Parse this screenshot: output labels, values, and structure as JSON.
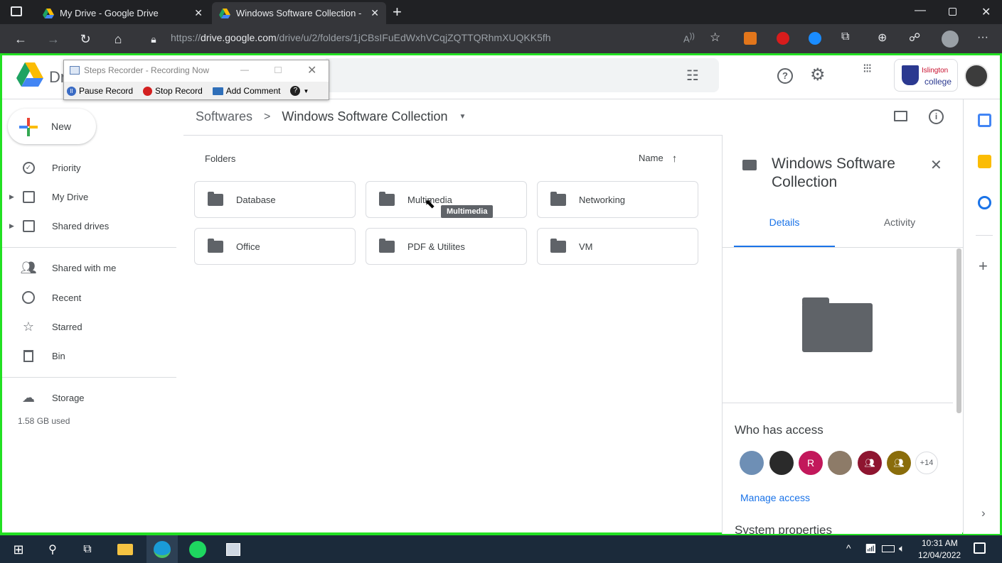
{
  "browser": {
    "tabs": [
      {
        "title": "My Drive - Google Drive",
        "active": false
      },
      {
        "title": "Windows Software Collection - S",
        "active": true
      }
    ],
    "url_prefix": "https://",
    "url_domain": "drive.google.com",
    "url_path": "/drive/u/2/folders/1jCBsIFuEdWxhVCqjZQTTQRhmXUQKK5fh"
  },
  "steps_recorder": {
    "title": "Steps Recorder - Recording Now",
    "pause": "Pause Record",
    "stop": "Stop Record",
    "comment": "Add Comment"
  },
  "drive": {
    "logo_text": "Dr",
    "org_line1": "Islington",
    "org_line2": "college"
  },
  "sidebar": {
    "new_label": "New",
    "items": [
      {
        "label": "Priority",
        "icon": "priority-icon"
      },
      {
        "label": "My Drive",
        "icon": "my-drive-icon"
      },
      {
        "label": "Shared drives",
        "icon": "shared-drives-icon"
      },
      {
        "label": "Shared with me",
        "icon": "shared-with-me-icon"
      },
      {
        "label": "Recent",
        "icon": "clock-icon"
      },
      {
        "label": "Starred",
        "icon": "star-icon"
      },
      {
        "label": "Bin",
        "icon": "trash-icon"
      }
    ],
    "storage_label": "Storage",
    "storage_used": "1.58 GB used"
  },
  "breadcrumb": {
    "parent": "Softwares",
    "separator": ">",
    "current": "Windows Software Collection"
  },
  "content": {
    "section_label": "Folders",
    "sort_label": "Name",
    "folders": [
      "Database",
      "Multimedia",
      "Networking",
      "Office",
      "PDF & Utilites",
      "VM"
    ],
    "tooltip": "Multimedia"
  },
  "details": {
    "title": "Windows Software Collection",
    "tabs": [
      "Details",
      "Activity"
    ],
    "access_heading": "Who has access",
    "avatar_letter": "R",
    "more_count": "+14",
    "manage_access": "Manage access",
    "system_properties": "System properties"
  },
  "taskbar": {
    "time": "10:31 AM",
    "date": "12/04/2022"
  },
  "colors": {
    "accent": "#1a73e8",
    "frame": "#22e022",
    "folder": "#5f6368"
  }
}
